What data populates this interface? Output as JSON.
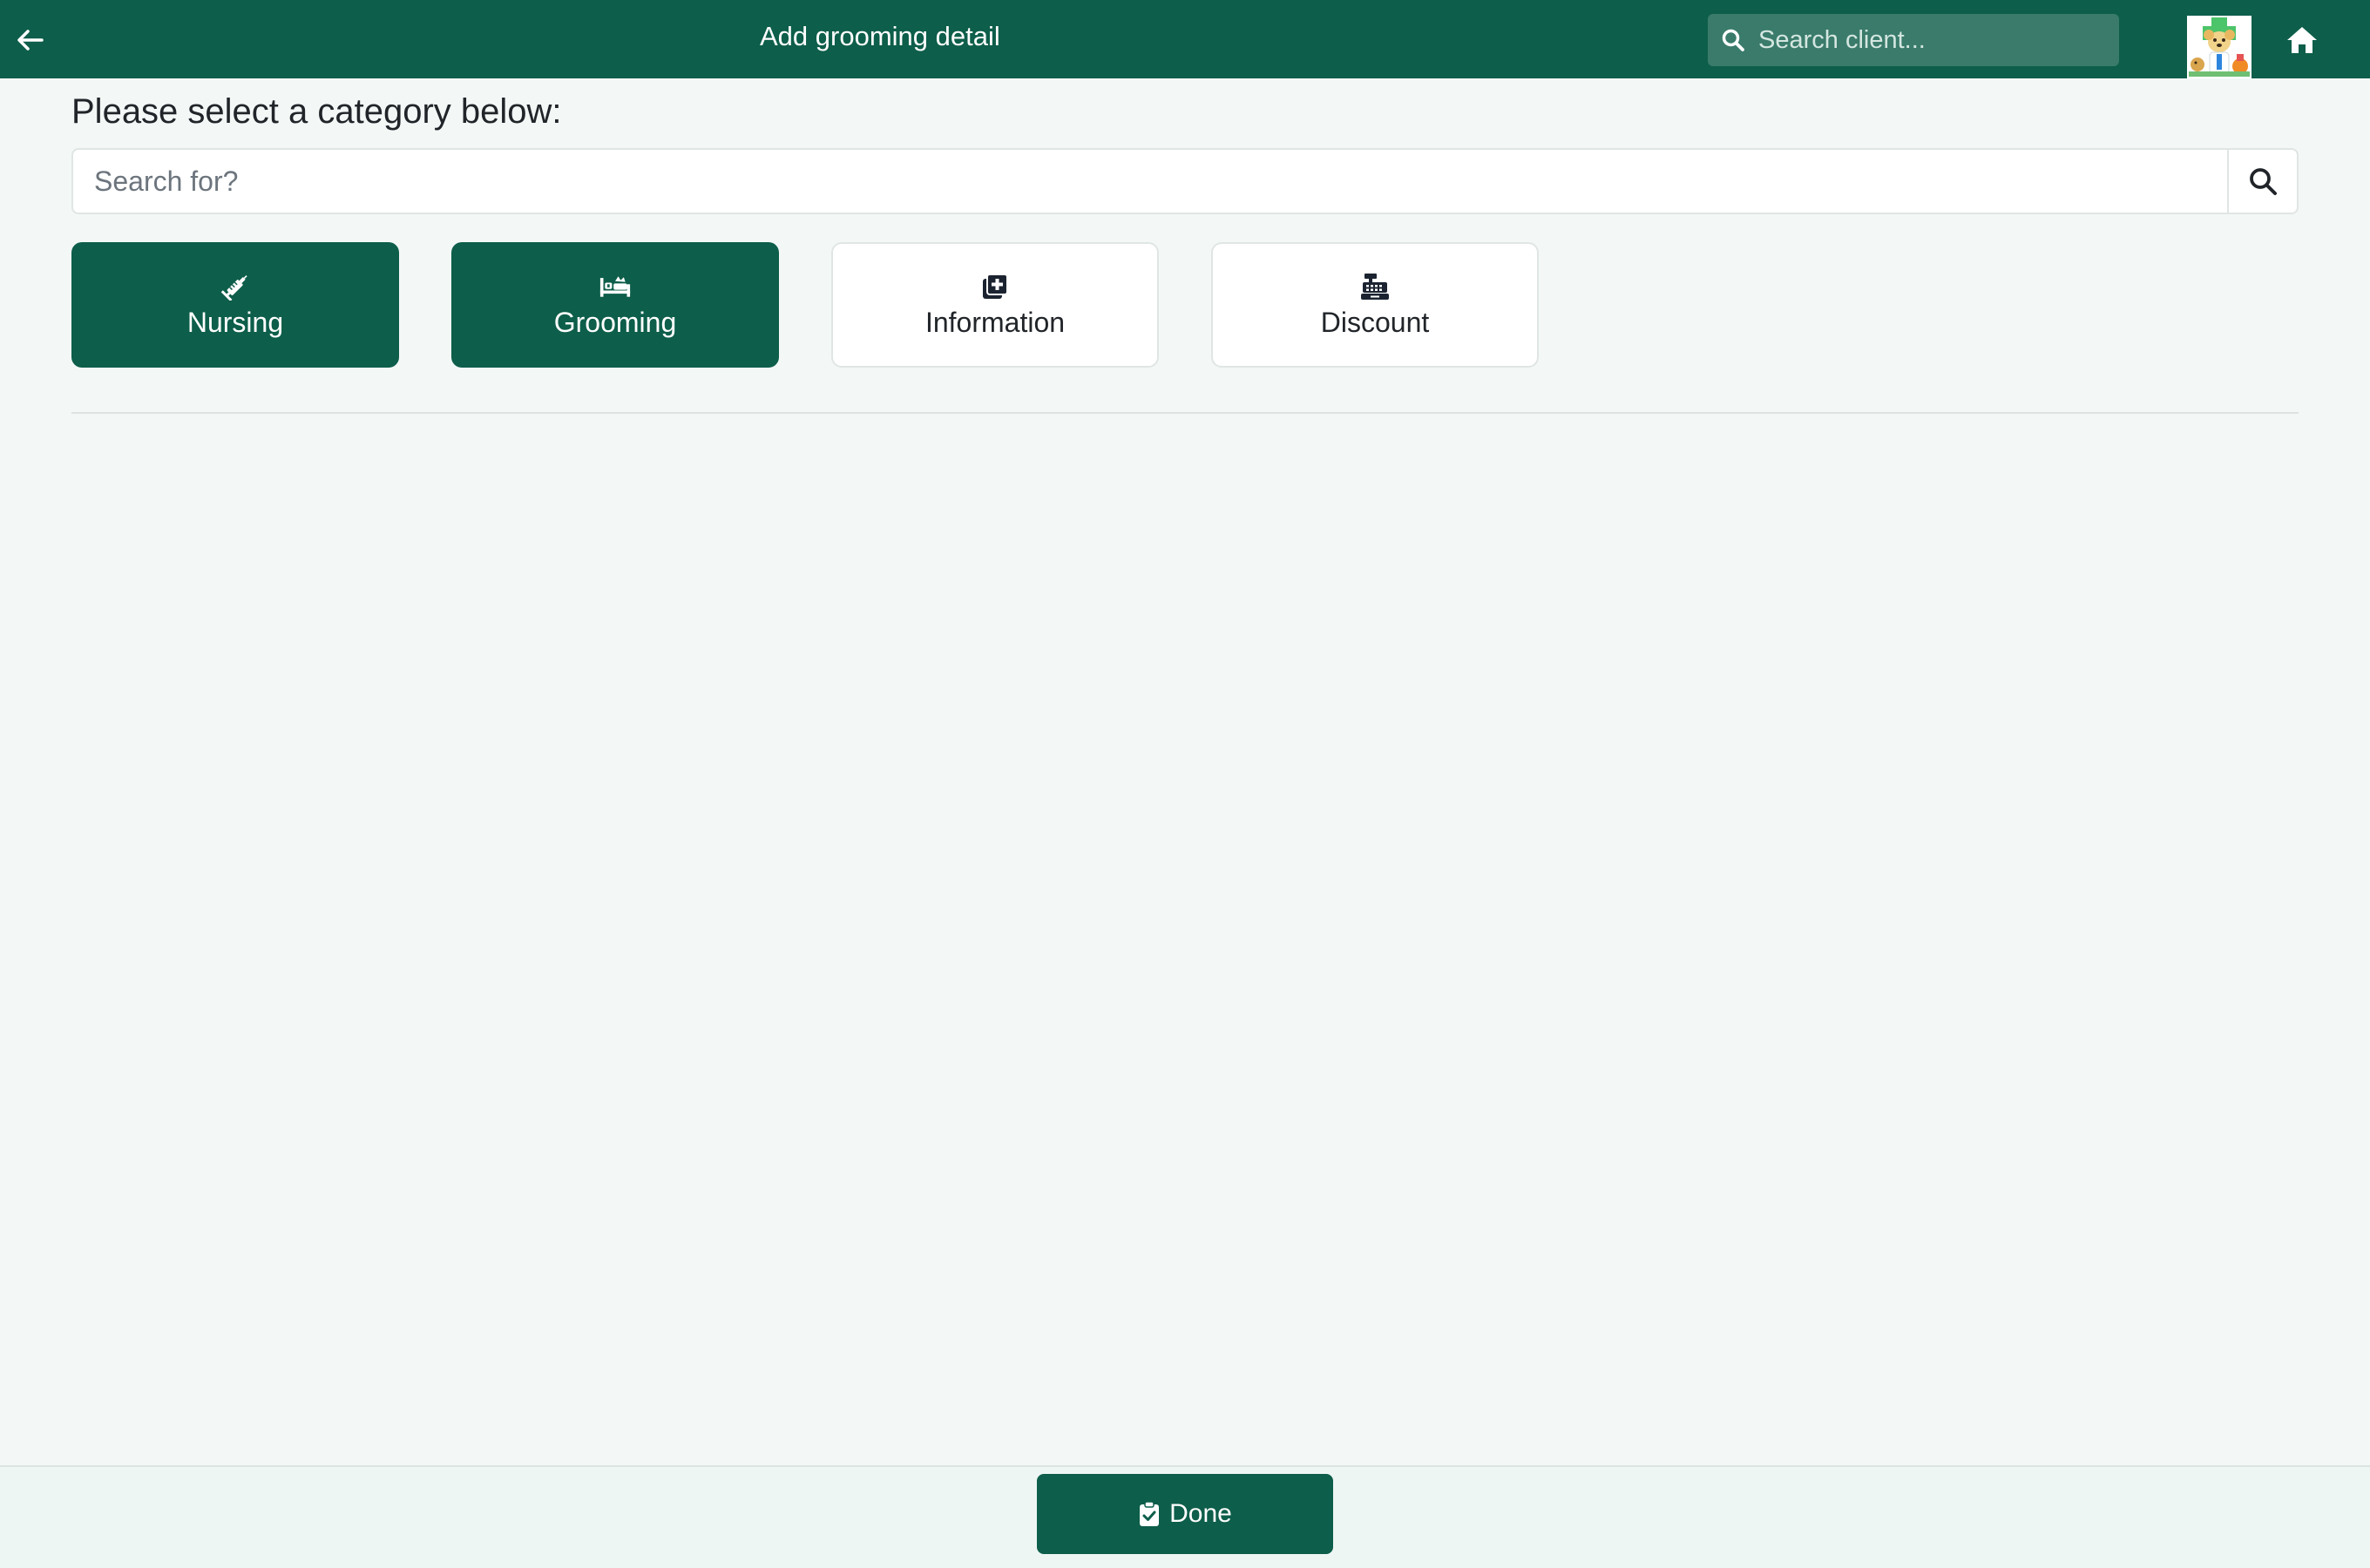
{
  "header": {
    "title": "Add grooming detail",
    "client_search_placeholder": "Search client...",
    "back_icon": "arrow-left-icon",
    "home_icon": "home-icon",
    "logo": "vet-clinic-logo"
  },
  "main": {
    "prompt": "Please select a category below:",
    "search_placeholder": "Search for?",
    "search_value": "",
    "categories": [
      {
        "label": "Nursing",
        "icon": "syringe-icon",
        "selected": true
      },
      {
        "label": "Grooming",
        "icon": "bed-pet-icon",
        "selected": true
      },
      {
        "label": "Information",
        "icon": "medical-files-icon",
        "selected": false
      },
      {
        "label": "Discount",
        "icon": "cash-register-icon",
        "selected": false
      }
    ]
  },
  "footer": {
    "done_label": "Done",
    "done_icon": "clipboard-check-icon"
  },
  "colors": {
    "primary": "#0d5e4a",
    "background": "#f3f8f7",
    "header_search_bg": "#3a7b6b"
  }
}
